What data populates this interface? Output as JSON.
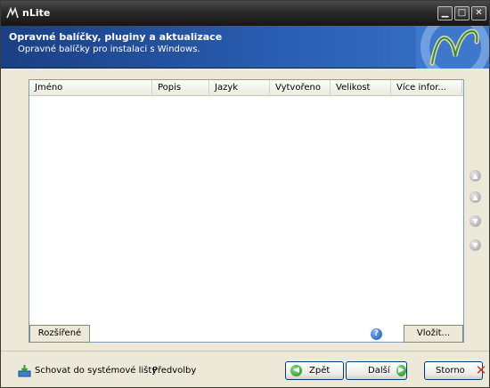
{
  "window": {
    "title": "nLite",
    "controls": {
      "minimize": "▁",
      "maximize": "□",
      "close": "✕"
    }
  },
  "header": {
    "title": "Opravné balíčky, pluginy a aktualizace",
    "subtitle": "Opravné balíčky pro instalaci s Windows."
  },
  "list": {
    "columns": [
      "Jméno",
      "Popis",
      "Jazyk",
      "Vytvořeno",
      "Velikost",
      "Více infor..."
    ],
    "rows": []
  },
  "panel": {
    "advanced_label": "Rozšířené",
    "insert_label": "Vložit...",
    "help_glyph": "?"
  },
  "side_buttons": {
    "up_glyph": "▲",
    "down_glyph": "▼"
  },
  "footer": {
    "hide_tray_label": "Schovat do systémové lišty",
    "prefs_label": "Předvolby",
    "back_label": "Zpět",
    "next_label": "Další",
    "cancel_label": "Storno",
    "back_glyph": "◀",
    "next_glyph": "▶",
    "cancel_glyph": "✕"
  },
  "colors": {
    "header_blue": "#1b3f84",
    "button_border": "#003c74",
    "nav_icon_green": "#1f8a1f",
    "cancel_red": "#c0392b"
  }
}
